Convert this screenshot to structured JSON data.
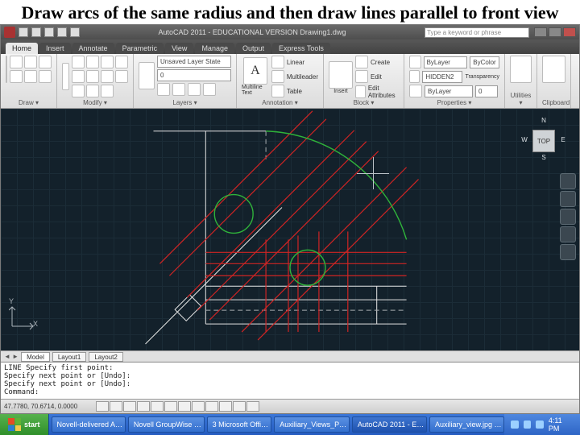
{
  "slide": {
    "title": "Draw arcs of the same radius and then draw lines parallel to front view"
  },
  "titlebar": {
    "app_title": "AutoCAD 2011 - EDUCATIONAL VERSION   Drawing1.dwg",
    "search_placeholder": "Type a keyword or phrase",
    "min_icon": "minimize",
    "max_icon": "maximize",
    "close_icon": "close"
  },
  "ribbon_tabs": [
    "Home",
    "Insert",
    "Annotate",
    "Parametric",
    "View",
    "Manage",
    "Output",
    "Express Tools"
  ],
  "ribbon_active_tab": "Home",
  "ribbon_panels": {
    "draw": {
      "label": "Draw ▾"
    },
    "modify": {
      "label": "Modify ▾"
    },
    "layers": {
      "label": "Layers ▾",
      "unsaved_state": "Unsaved Layer State",
      "current_layer": "0"
    },
    "annotation": {
      "label": "Annotation ▾",
      "multiline_text": "Multiline Text",
      "items": [
        "Linear",
        "Multileader",
        "Table"
      ]
    },
    "block": {
      "label": "Block ▾",
      "insert": "Insert",
      "items": [
        "Create",
        "Edit",
        "Edit Attributes"
      ]
    },
    "properties": {
      "label": "Properties ▾",
      "layer_selector": "ByLayer",
      "color_selector": "ByColor",
      "ltype_selector": "HIDDEN2",
      "transparency_label": "Transparency",
      "transparency_value": "0"
    },
    "utilities": {
      "label": "Utilities ▾"
    },
    "clipboard": {
      "label": "Clipboard"
    }
  },
  "command_window": {
    "lines": [
      "LINE Specify first point:",
      "Specify next point or [Undo]:",
      "Specify next point or [Undo]:"
    ],
    "prompt": "Command:"
  },
  "status_bar": {
    "coords": "47.7780, 70.6714, 0.0000"
  },
  "layout_tabs": {
    "model": "Model",
    "layout1": "Layout1",
    "layout2": "Layout2"
  },
  "viewcube": {
    "face": "TOP",
    "n": "N",
    "s": "S",
    "e": "E",
    "w": "W"
  },
  "taskbar": {
    "start": "start",
    "items": [
      "Novell-delivered A…",
      "Novell GroupWise …",
      "3 Microsoft Offi… ",
      "Auxiliary_Views_P…",
      "AutoCAD 2011 - E…",
      "Auxiliary_view.jpg …"
    ],
    "clock": "4:11 PM"
  },
  "icons": {
    "app": "autocad-app-icon",
    "qat": [
      "new-icon",
      "open-icon",
      "save-icon",
      "undo-icon",
      "redo-icon",
      "print-icon"
    ]
  }
}
